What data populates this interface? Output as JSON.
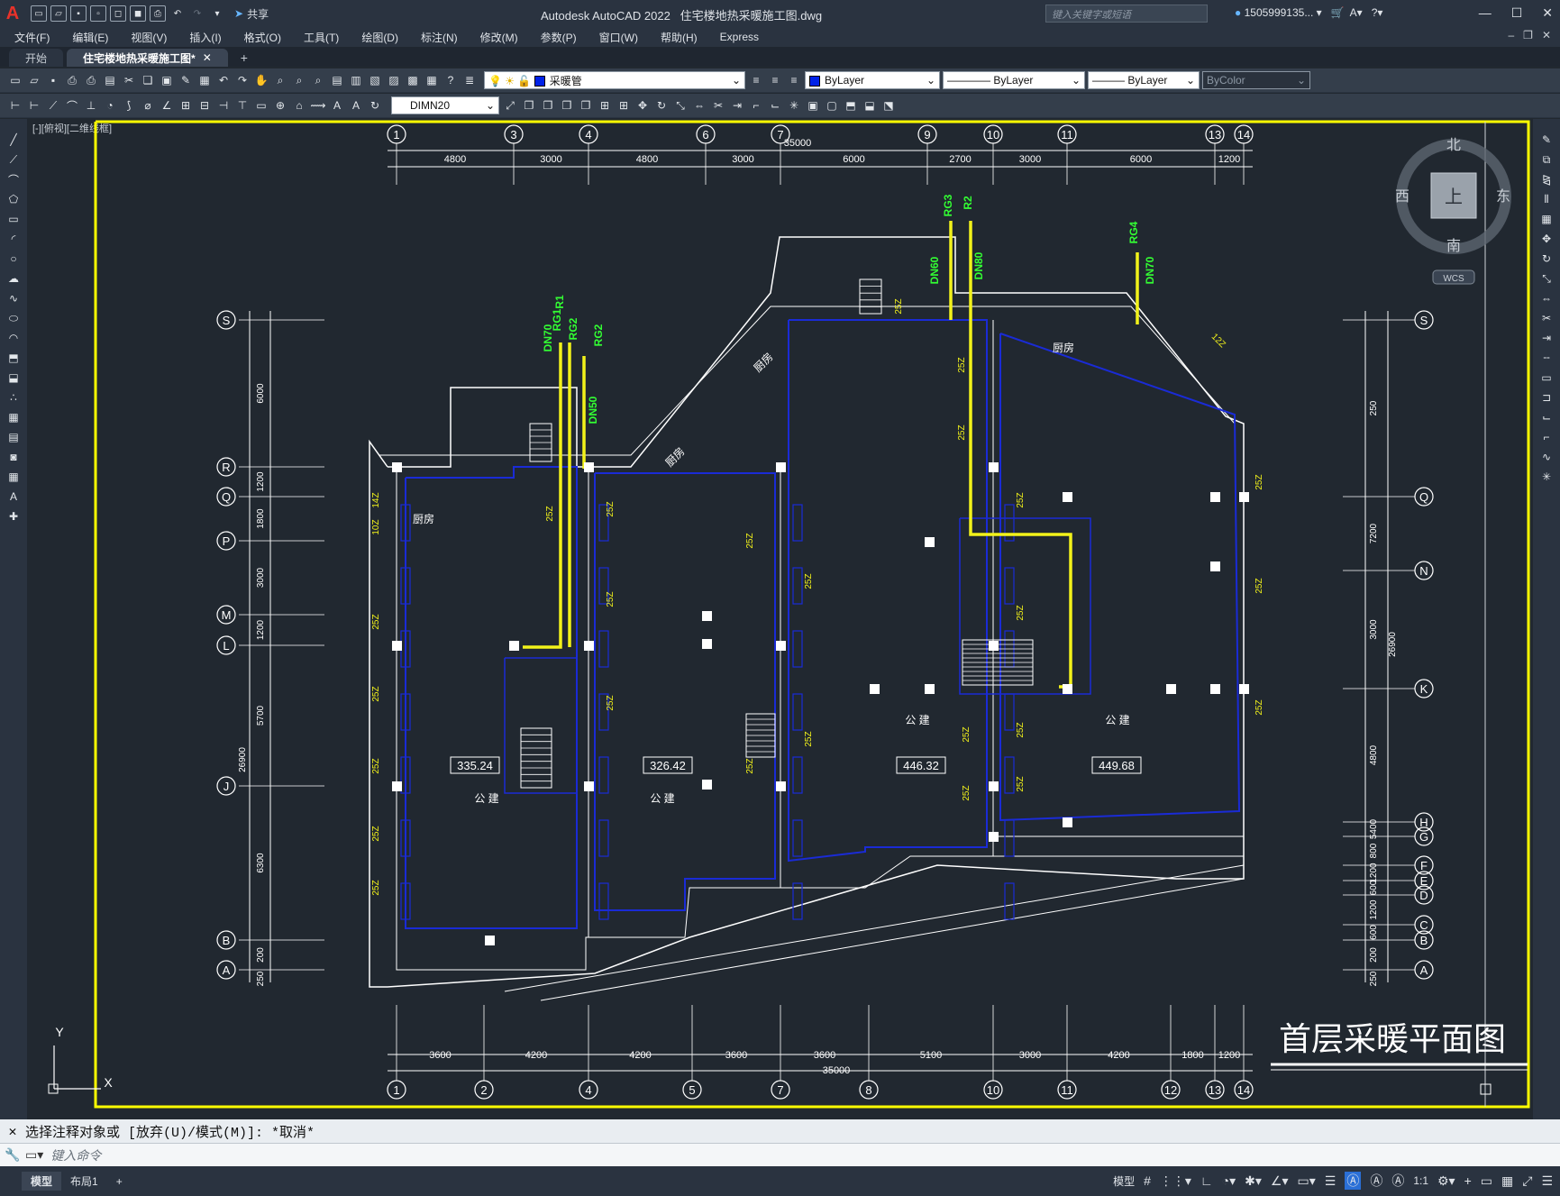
{
  "app": {
    "name": "Autodesk AutoCAD 2022",
    "file": "住宅楼地热采暖施工图.dwg",
    "share_label": "共享",
    "search_placeholder": "键入关键字或短语",
    "user": "1505999135...",
    "help_label": "?"
  },
  "menu": [
    "文件(F)",
    "编辑(E)",
    "视图(V)",
    "插入(I)",
    "格式(O)",
    "工具(T)",
    "绘图(D)",
    "标注(N)",
    "修改(M)",
    "参数(P)",
    "窗口(W)",
    "帮助(H)",
    "Express"
  ],
  "tabs": [
    {
      "label": "开始",
      "active": false
    },
    {
      "label": "住宅楼地热采暖施工图*",
      "active": true
    }
  ],
  "layer": {
    "name": "采暖管"
  },
  "properties": {
    "color": "ByLayer",
    "linetype": "ByLayer",
    "lineweight": "ByLayer",
    "plotstyle": "ByColor"
  },
  "dimstyle": "DIMN20",
  "viewport_label": "[-][俯视][二维线框]",
  "viewcube": {
    "north": "北",
    "south": "南",
    "east": "东",
    "west": "西",
    "top": "上",
    "wcs": "WCS"
  },
  "drawing": {
    "title": "首层采暖平面图",
    "total_width": "35000",
    "total_height": "26900",
    "top_axes": [
      "1",
      "3",
      "4",
      "6",
      "7",
      "9",
      "10",
      "11",
      "13",
      "14"
    ],
    "top_dims": [
      "4800",
      "3000",
      "4800",
      "3000",
      "6000",
      "2700",
      "3000",
      "6000",
      "1200"
    ],
    "bottom_axes": [
      "1",
      "2",
      "4",
      "5",
      "7",
      "8",
      "10",
      "11",
      "12",
      "13",
      "14"
    ],
    "bottom_dims": [
      "3600",
      "4200",
      "4200",
      "3600",
      "3600",
      "5100",
      "3000",
      "4200",
      "1800",
      "1200"
    ],
    "left_axes": [
      "S",
      "R",
      "Q",
      "P",
      "M",
      "L",
      "J",
      "B",
      "A"
    ],
    "left_dims": [
      "6000",
      "1200",
      "1800",
      "3000",
      "1200",
      "5700",
      "6300",
      "200",
      "250"
    ],
    "right_axes": [
      "S",
      "Q",
      "N",
      "K",
      "H",
      "G",
      "F",
      "E",
      "D",
      "C",
      "B",
      "A"
    ],
    "right_dims": [
      "250",
      "7200",
      "3000",
      "4800",
      "5400",
      "800",
      "1200",
      "600",
      "1200",
      "600",
      "200",
      "250"
    ],
    "areas": [
      "335.24",
      "326.42",
      "446.32",
      "449.68"
    ],
    "room_label": "公 建",
    "kitchen_label": "厨房",
    "pipes": [
      "RG1",
      "R1",
      "RG2",
      "RG3",
      "R2",
      "RG4"
    ],
    "pipe_sizes": [
      "DN70",
      "DN50",
      "DN60",
      "DN80",
      "DN70"
    ],
    "coil_tags": [
      "25Z",
      "10Z",
      "14Z",
      "12Z"
    ]
  },
  "command": {
    "history": "选择注释对象或 [放弃(U)/模式(M)]: *取消*",
    "placeholder": "键入命令"
  },
  "status_tabs": [
    "模型",
    "布局1"
  ],
  "status": {
    "model_label": "模型",
    "scale": "1:1"
  },
  "colors": {
    "background": "#212830",
    "wall": "#ffffff",
    "coil": "#1a2bd6",
    "pipe": "#f2f21a",
    "pipe_label": "#33ff33",
    "frame": "#ffff00",
    "dim": "#ffffff"
  }
}
